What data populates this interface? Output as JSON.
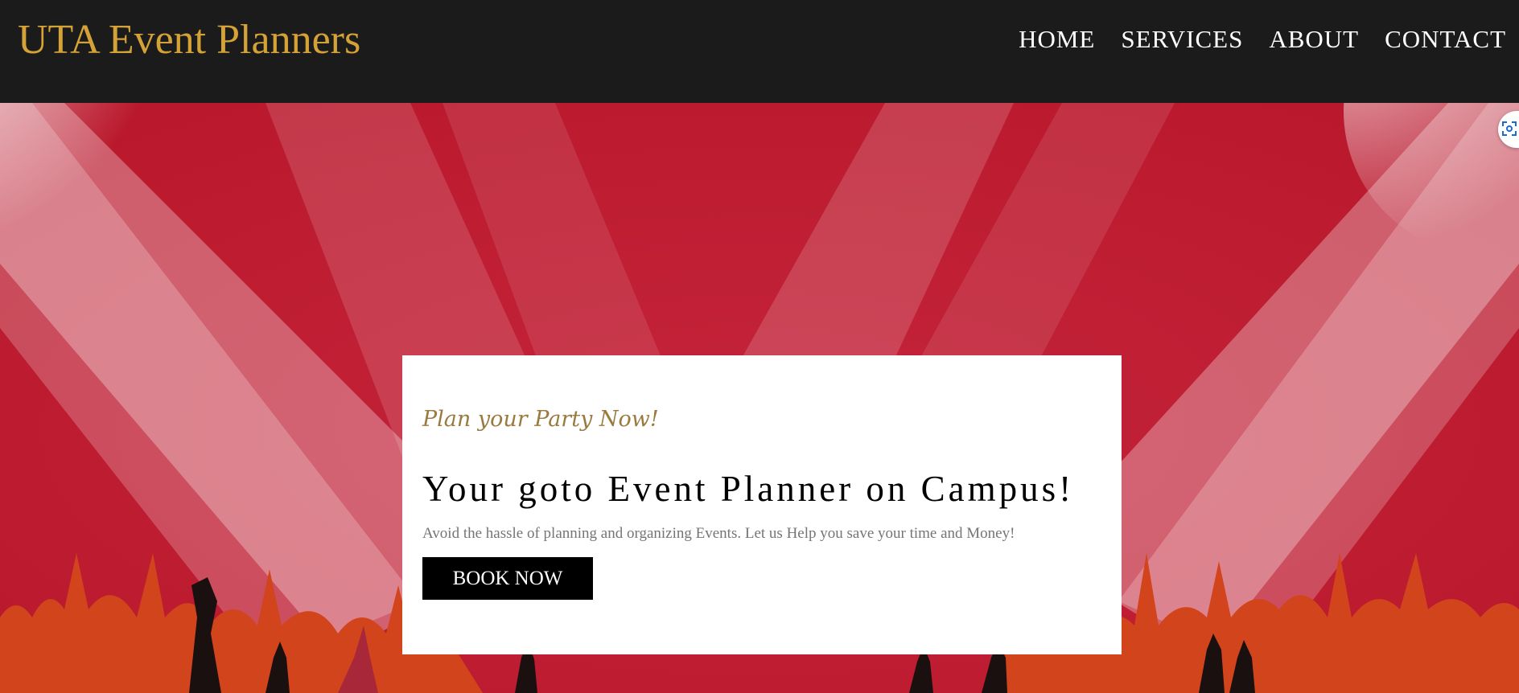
{
  "header": {
    "brand": "UTA Event Planners",
    "nav": [
      "HOME",
      "SERVICES",
      "ABOUT",
      "CONTACT"
    ]
  },
  "hero": {
    "tagline": "Plan your Party Now!",
    "headline": "Your goto Event Planner on Campus!",
    "subtext": "Avoid the hassle of planning and organizing Events. Let us Help you save your time and Money!",
    "cta_label": "BOOK NOW"
  },
  "icons": [
    "spotlight-beam-icon",
    "crowd-silhouette-icon",
    "scan-icon"
  ],
  "colors": {
    "navbar_bg": "#1b1b1b",
    "brand": "#d4a236",
    "hero_red": "#bb1b2b",
    "tagline": "#9a7a3f",
    "cta_bg": "#000000",
    "crowd_orange": "#d2441c"
  }
}
